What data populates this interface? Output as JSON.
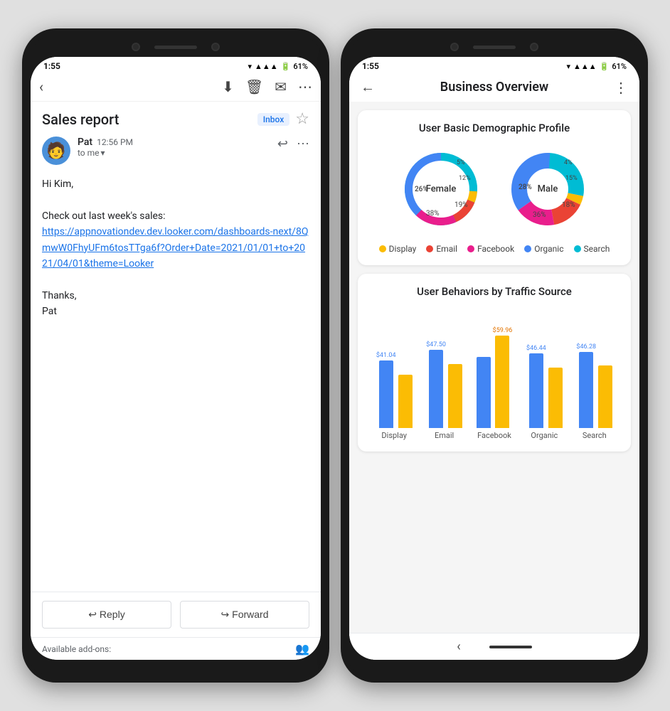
{
  "phone_left": {
    "status": {
      "time": "1:55",
      "battery": "61%"
    },
    "toolbar": {
      "back": "‹",
      "download": "⬇",
      "delete": "🗑",
      "mail": "✉",
      "more": "⋮"
    },
    "email": {
      "subject": "Sales report",
      "badge": "Inbox",
      "from": "Pat",
      "time": "12:56 PM",
      "to": "to me",
      "greeting": "Hi Kim,",
      "body1": "Check out last week's sales:",
      "link": "https://appnovationdev.dev.looker.com/dashboards-next/8QmwW0FhyUFm6tosTTga6f?Order+Date=2021/01/01+to+2021/04/01&theme=Looker",
      "closing": "Thanks,",
      "sign": "Pat",
      "reply_btn": "↩ Reply",
      "forward_btn": "↪ Forward",
      "add_ons": "Available add-ons:"
    }
  },
  "phone_right": {
    "status": {
      "time": "1:55",
      "battery": "61%"
    },
    "header": {
      "title": "Business Overview",
      "back": "←",
      "more": "⋮"
    },
    "demographic_card": {
      "title": "User Basic Demographic Profile",
      "female_chart": {
        "label": "Female",
        "segments": [
          {
            "label": "Display",
            "pct": 5,
            "color": "#fbbc04",
            "text_pct": "5%"
          },
          {
            "label": "Email",
            "pct": 12,
            "color": "#ea4335",
            "text_pct": "12%"
          },
          {
            "label": "Facebook",
            "pct": 19,
            "color": "#e91e8c",
            "text_pct": "19%"
          },
          {
            "label": "Organic",
            "pct": 38,
            "color": "#4285f4",
            "text_pct": "38%"
          },
          {
            "label": "Search",
            "pct": 26,
            "color": "#00bcd4",
            "text_pct": "26%"
          }
        ]
      },
      "male_chart": {
        "label": "Male",
        "segments": [
          {
            "label": "Display",
            "pct": 4,
            "color": "#fbbc04",
            "text_pct": "4%"
          },
          {
            "label": "Email",
            "pct": 15,
            "color": "#ea4335",
            "text_pct": "15%"
          },
          {
            "label": "Facebook",
            "pct": 18,
            "color": "#e91e8c",
            "text_pct": "18%"
          },
          {
            "label": "Organic",
            "pct": 36,
            "color": "#4285f4",
            "text_pct": "36%"
          },
          {
            "label": "Search",
            "pct": 28,
            "color": "#00bcd4",
            "text_pct": "28%"
          }
        ]
      },
      "legend": [
        {
          "label": "Display",
          "color": "#fbbc04"
        },
        {
          "label": "Email",
          "color": "#ea4335"
        },
        {
          "label": "Facebook",
          "color": "#e91e8c"
        },
        {
          "label": "Organic",
          "color": "#4285f4"
        },
        {
          "label": "Search",
          "color": "#00bcd4"
        }
      ]
    },
    "behaviors_card": {
      "title": "User Behaviors by Traffic Source",
      "bars": [
        {
          "label": "Display",
          "blue_val": "$41.04",
          "orange_val": "",
          "blue_h": 95,
          "orange_h": 75
        },
        {
          "label": "Email",
          "blue_val": "$47.50",
          "orange_val": "",
          "blue_h": 110,
          "orange_h": 90
        },
        {
          "label": "Facebook",
          "blue_val": "",
          "orange_val": "$59.96",
          "blue_h": 100,
          "orange_h": 130
        },
        {
          "label": "Organic",
          "blue_val": "$46.44",
          "orange_val": "",
          "blue_h": 105,
          "orange_h": 85
        },
        {
          "label": "Search",
          "blue_val": "$46.28",
          "orange_val": "",
          "blue_h": 107,
          "orange_h": 88
        }
      ]
    }
  }
}
